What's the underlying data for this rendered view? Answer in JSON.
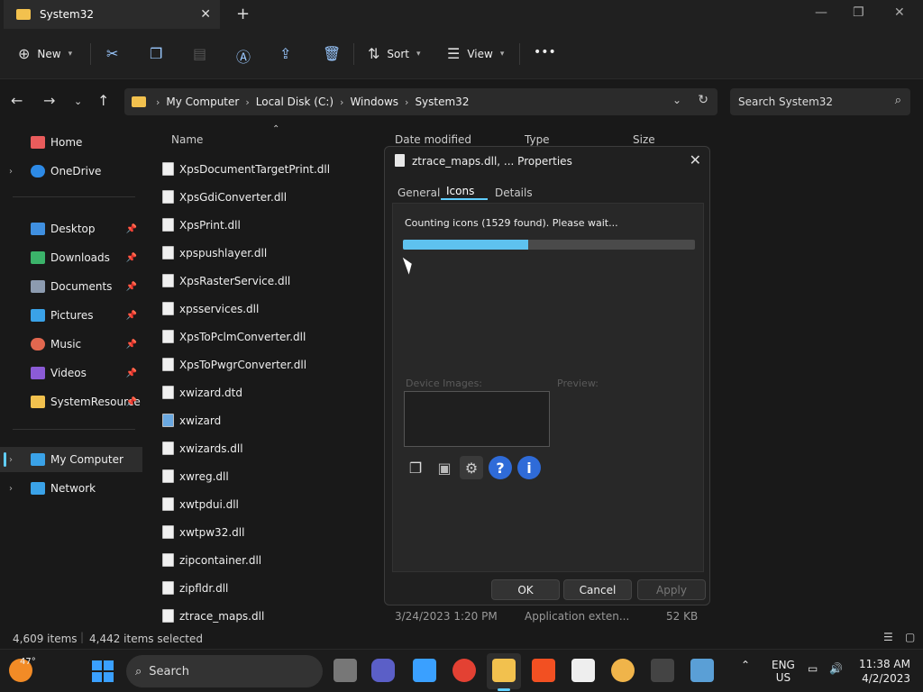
{
  "window": {
    "tab_title": "System32",
    "new_tab": "+",
    "close": "✕"
  },
  "toolbar": {
    "new_label": "New",
    "sort_label": "Sort",
    "view_label": "View",
    "more_label": "•••"
  },
  "address": {
    "crumbs": [
      "My Computer",
      "Local Disk (C:)",
      "Windows",
      "System32"
    ],
    "search_placeholder": "Search System32"
  },
  "sidebar": {
    "items": [
      {
        "label": "Home",
        "color": "#e95c5c"
      },
      {
        "label": "OneDrive",
        "color": "#2d8ae6"
      },
      {
        "label": "Desktop",
        "color": "#3f8fe0"
      },
      {
        "label": "Downloads",
        "color": "#3bb36a"
      },
      {
        "label": "Documents",
        "color": "#8c9bb0"
      },
      {
        "label": "Pictures",
        "color": "#3aa2e8"
      },
      {
        "label": "Music",
        "color": "#e2674f"
      },
      {
        "label": "Videos",
        "color": "#8b5bd6"
      },
      {
        "label": "SystemResource",
        "color": "#f2c14e"
      },
      {
        "label": "My Computer",
        "color": "#3aa2e8"
      },
      {
        "label": "Network",
        "color": "#3aa2e8"
      }
    ]
  },
  "columns": {
    "name": "Name",
    "date": "Date modified",
    "type": "Type",
    "size": "Size"
  },
  "files": [
    "XpsDocumentTargetPrint.dll",
    "XpsGdiConverter.dll",
    "XpsPrint.dll",
    "xpspushlayer.dll",
    "XpsRasterService.dll",
    "xpsservices.dll",
    "XpsToPclmConverter.dll",
    "XpsToPwgrConverter.dll",
    "xwizard.dtd",
    "xwizard",
    "xwizards.dll",
    "xwreg.dll",
    "xwtpdui.dll",
    "xwtpw32.dll",
    "zipcontainer.dll",
    "zipfldr.dll",
    "ztrace_maps.dll"
  ],
  "last_row": {
    "date": "3/24/2023 1:20 PM",
    "type": "Application exten...",
    "size": "52 KB"
  },
  "status": {
    "items": "4,609 items",
    "selected": "4,442 items selected"
  },
  "dialog": {
    "title": "ztrace_maps.dll, ... Properties",
    "tabs": [
      "General",
      "Icons",
      "Details"
    ],
    "counting": "Counting icons (1529 found). Please wait...",
    "progress_fraction": 0.43,
    "device_images": "Device Images:",
    "preview": "Preview:",
    "ok": "OK",
    "cancel": "Cancel",
    "apply": "Apply"
  },
  "taskbar": {
    "temp": "47°",
    "search": "Search",
    "lang1": "ENG",
    "lang2": "US",
    "time": "11:38 AM",
    "date": "4/2/2023"
  }
}
